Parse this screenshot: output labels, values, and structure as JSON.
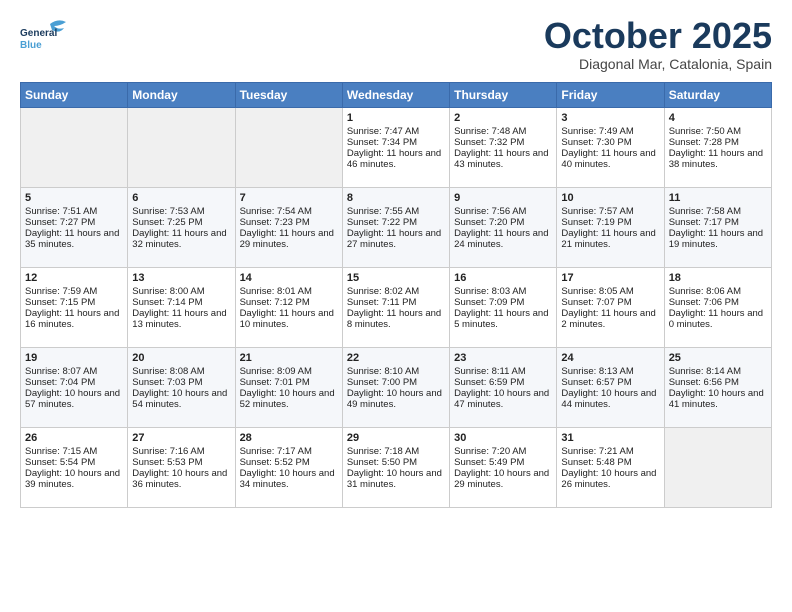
{
  "header": {
    "logo_general": "General",
    "logo_blue": "Blue",
    "month_title": "October 2025",
    "location": "Diagonal Mar, Catalonia, Spain"
  },
  "days_of_week": [
    "Sunday",
    "Monday",
    "Tuesday",
    "Wednesday",
    "Thursday",
    "Friday",
    "Saturday"
  ],
  "weeks": [
    [
      {
        "day": "",
        "empty": true
      },
      {
        "day": "",
        "empty": true
      },
      {
        "day": "",
        "empty": true
      },
      {
        "day": "1",
        "sunrise": "7:47 AM",
        "sunset": "7:34 PM",
        "daylight": "11 hours and 46 minutes."
      },
      {
        "day": "2",
        "sunrise": "7:48 AM",
        "sunset": "7:32 PM",
        "daylight": "11 hours and 43 minutes."
      },
      {
        "day": "3",
        "sunrise": "7:49 AM",
        "sunset": "7:30 PM",
        "daylight": "11 hours and 40 minutes."
      },
      {
        "day": "4",
        "sunrise": "7:50 AM",
        "sunset": "7:28 PM",
        "daylight": "11 hours and 38 minutes."
      }
    ],
    [
      {
        "day": "5",
        "sunrise": "7:51 AM",
        "sunset": "7:27 PM",
        "daylight": "11 hours and 35 minutes."
      },
      {
        "day": "6",
        "sunrise": "7:53 AM",
        "sunset": "7:25 PM",
        "daylight": "11 hours and 32 minutes."
      },
      {
        "day": "7",
        "sunrise": "7:54 AM",
        "sunset": "7:23 PM",
        "daylight": "11 hours and 29 minutes."
      },
      {
        "day": "8",
        "sunrise": "7:55 AM",
        "sunset": "7:22 PM",
        "daylight": "11 hours and 27 minutes."
      },
      {
        "day": "9",
        "sunrise": "7:56 AM",
        "sunset": "7:20 PM",
        "daylight": "11 hours and 24 minutes."
      },
      {
        "day": "10",
        "sunrise": "7:57 AM",
        "sunset": "7:19 PM",
        "daylight": "11 hours and 21 minutes."
      },
      {
        "day": "11",
        "sunrise": "7:58 AM",
        "sunset": "7:17 PM",
        "daylight": "11 hours and 19 minutes."
      }
    ],
    [
      {
        "day": "12",
        "sunrise": "7:59 AM",
        "sunset": "7:15 PM",
        "daylight": "11 hours and 16 minutes."
      },
      {
        "day": "13",
        "sunrise": "8:00 AM",
        "sunset": "7:14 PM",
        "daylight": "11 hours and 13 minutes."
      },
      {
        "day": "14",
        "sunrise": "8:01 AM",
        "sunset": "7:12 PM",
        "daylight": "11 hours and 10 minutes."
      },
      {
        "day": "15",
        "sunrise": "8:02 AM",
        "sunset": "7:11 PM",
        "daylight": "11 hours and 8 minutes."
      },
      {
        "day": "16",
        "sunrise": "8:03 AM",
        "sunset": "7:09 PM",
        "daylight": "11 hours and 5 minutes."
      },
      {
        "day": "17",
        "sunrise": "8:05 AM",
        "sunset": "7:07 PM",
        "daylight": "11 hours and 2 minutes."
      },
      {
        "day": "18",
        "sunrise": "8:06 AM",
        "sunset": "7:06 PM",
        "daylight": "11 hours and 0 minutes."
      }
    ],
    [
      {
        "day": "19",
        "sunrise": "8:07 AM",
        "sunset": "7:04 PM",
        "daylight": "10 hours and 57 minutes."
      },
      {
        "day": "20",
        "sunrise": "8:08 AM",
        "sunset": "7:03 PM",
        "daylight": "10 hours and 54 minutes."
      },
      {
        "day": "21",
        "sunrise": "8:09 AM",
        "sunset": "7:01 PM",
        "daylight": "10 hours and 52 minutes."
      },
      {
        "day": "22",
        "sunrise": "8:10 AM",
        "sunset": "7:00 PM",
        "daylight": "10 hours and 49 minutes."
      },
      {
        "day": "23",
        "sunrise": "8:11 AM",
        "sunset": "6:59 PM",
        "daylight": "10 hours and 47 minutes."
      },
      {
        "day": "24",
        "sunrise": "8:13 AM",
        "sunset": "6:57 PM",
        "daylight": "10 hours and 44 minutes."
      },
      {
        "day": "25",
        "sunrise": "8:14 AM",
        "sunset": "6:56 PM",
        "daylight": "10 hours and 41 minutes."
      }
    ],
    [
      {
        "day": "26",
        "sunrise": "7:15 AM",
        "sunset": "5:54 PM",
        "daylight": "10 hours and 39 minutes."
      },
      {
        "day": "27",
        "sunrise": "7:16 AM",
        "sunset": "5:53 PM",
        "daylight": "10 hours and 36 minutes."
      },
      {
        "day": "28",
        "sunrise": "7:17 AM",
        "sunset": "5:52 PM",
        "daylight": "10 hours and 34 minutes."
      },
      {
        "day": "29",
        "sunrise": "7:18 AM",
        "sunset": "5:50 PM",
        "daylight": "10 hours and 31 minutes."
      },
      {
        "day": "30",
        "sunrise": "7:20 AM",
        "sunset": "5:49 PM",
        "daylight": "10 hours and 29 minutes."
      },
      {
        "day": "31",
        "sunrise": "7:21 AM",
        "sunset": "5:48 PM",
        "daylight": "10 hours and 26 minutes."
      },
      {
        "day": "",
        "empty": true
      }
    ]
  ],
  "labels": {
    "sunrise_label": "Sunrise:",
    "sunset_label": "Sunset:",
    "daylight_label": "Daylight:"
  }
}
